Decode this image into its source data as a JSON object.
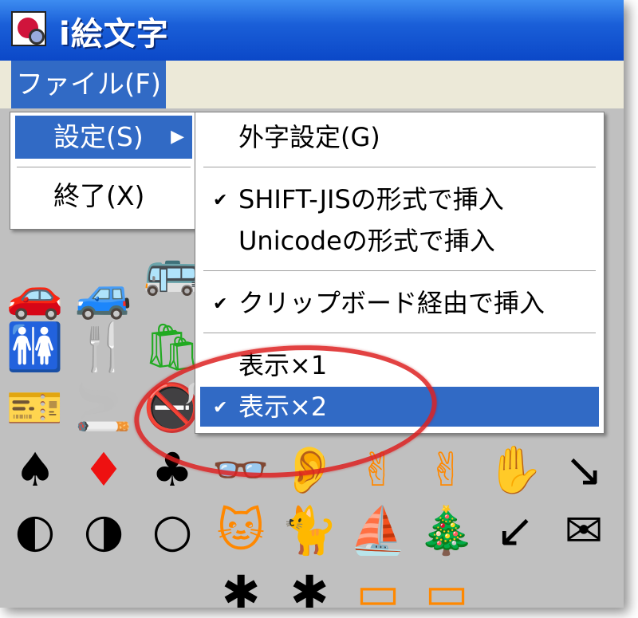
{
  "window": {
    "title": "i絵文字"
  },
  "menubar": {
    "file_label": "ファイル(F)"
  },
  "file_menu": {
    "settings_label": "設定(S)",
    "settings_arrow": "▶",
    "exit_label": "終了(X)"
  },
  "submenu": {
    "gaiji_label": "外字設定(G)",
    "shiftjis_label": "SHIFT-JISの形式で挿入",
    "shiftjis_checked": "✔",
    "unicode_label": "Unicodeの形式で挿入",
    "clipboard_label": "クリップボード経由で挿入",
    "clipboard_checked": "✔",
    "zoom1_label": "表示×1",
    "zoom2_label": "表示×2",
    "zoom2_checked": "✔"
  },
  "colors": {
    "titlebar": "#0b48c8",
    "menu_highlight": "#316ac5",
    "annotation": "#dd2222",
    "grid_background": "#c0c0c0"
  },
  "emoji_icons": [
    "car-icon",
    "car-green-icon",
    "bus-icon",
    "restroom-icon",
    "restaurant-icon",
    "shop-icon",
    "ticket-icon",
    "no-smoking-icon",
    "spade-icon",
    "diamond-icon",
    "club-icon",
    "glasses-icon",
    "ear-icon",
    "peace-hand-icon",
    "open-hand-icon",
    "arrow-down-right-icon",
    "moon-icon",
    "circle-icon",
    "cat-icon",
    "sailboat-icon",
    "tree-icon",
    "arrow-down-left-icon",
    "mail-icon"
  ]
}
